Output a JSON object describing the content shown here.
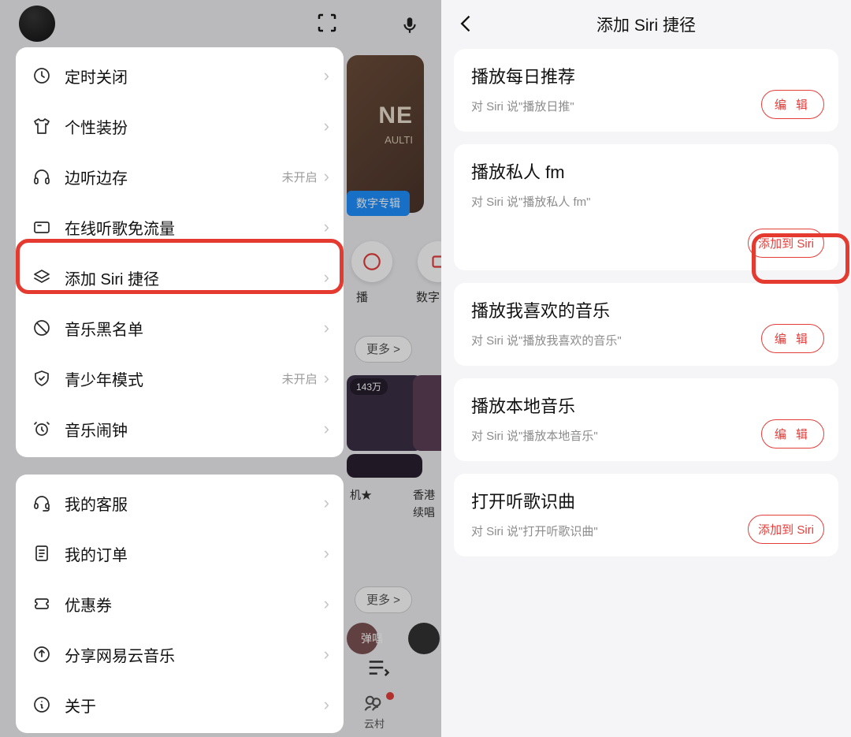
{
  "bg": {
    "bannerBig": "NE",
    "bannerSmall": "AULTI",
    "pill": "数字专辑",
    "circleLbl1": "播",
    "circleLbl2": "数字",
    "more": "更多 >",
    "badge143": "143万",
    "cap1": "机★",
    "cap2a": "香港",
    "cap2b": "续唱",
    "pillTag": "弹唱",
    "tabCloud": "云村"
  },
  "panel": {
    "rows1": [
      {
        "label": "定时关闭",
        "icon": "clock",
        "status": ""
      },
      {
        "label": "个性装扮",
        "icon": "shirt",
        "status": ""
      },
      {
        "label": "边听边存",
        "icon": "headphones",
        "status": "未开启"
      },
      {
        "label": "在线听歌免流量",
        "icon": "card",
        "status": ""
      },
      {
        "label": "添加 Siri 捷径",
        "icon": "layers",
        "status": ""
      },
      {
        "label": "音乐黑名单",
        "icon": "ban",
        "status": ""
      },
      {
        "label": "青少年模式",
        "icon": "shield",
        "status": "未开启"
      },
      {
        "label": "音乐闹钟",
        "icon": "alarm",
        "status": ""
      }
    ],
    "rows2": [
      {
        "label": "我的客服",
        "icon": "headset"
      },
      {
        "label": "我的订单",
        "icon": "doc"
      },
      {
        "label": "优惠券",
        "icon": "ticket"
      },
      {
        "label": "分享网易云音乐",
        "icon": "share"
      },
      {
        "label": "关于",
        "icon": "info"
      }
    ]
  },
  "right": {
    "title": "添加 Siri 捷径",
    "items": [
      {
        "title": "播放每日推荐",
        "sub": "对 Siri 说\"播放日推\"",
        "btn": "编 辑",
        "kind": "edit"
      },
      {
        "title": "播放私人 fm",
        "sub": "对 Siri 说\"播放私人 fm\"",
        "btn": "添加到 Siri",
        "kind": "add"
      },
      {
        "title": "播放我喜欢的音乐",
        "sub": "对 Siri 说\"播放我喜欢的音乐\"",
        "btn": "编 辑",
        "kind": "edit"
      },
      {
        "title": "播放本地音乐",
        "sub": "对 Siri 说\"播放本地音乐\"",
        "btn": "编 辑",
        "kind": "edit"
      },
      {
        "title": "打开听歌识曲",
        "sub": "对 Siri 说\"打开听歌识曲\"",
        "btn": "添加到 Siri",
        "kind": "add"
      }
    ]
  }
}
